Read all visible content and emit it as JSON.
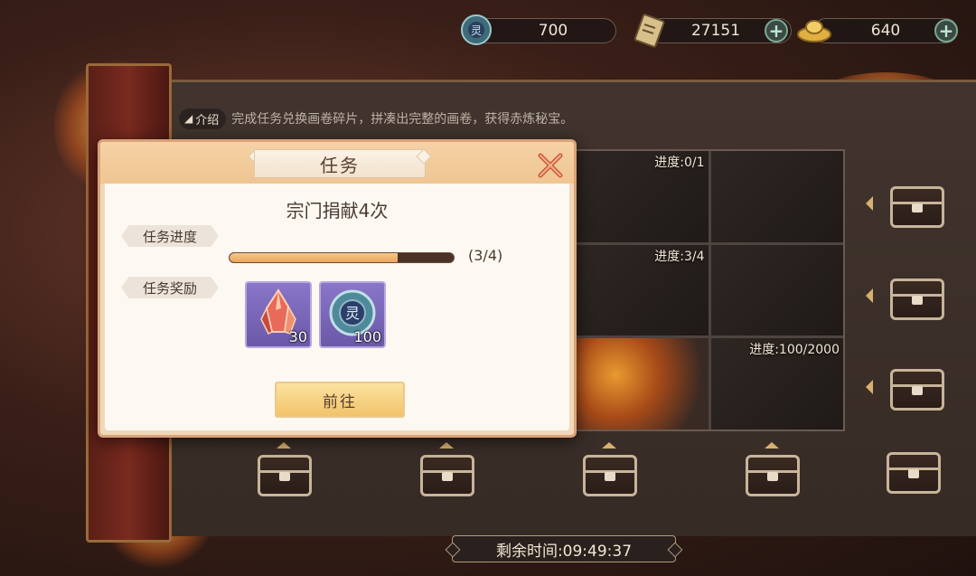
{
  "currencies": [
    {
      "value": "700",
      "icon": "jade-token-icon"
    },
    {
      "value": "27151",
      "icon": "scroll-ticket-icon"
    },
    {
      "value": "640",
      "icon": "gold-ingot-icon"
    }
  ],
  "intro": {
    "tag": "介绍",
    "text": "完成任务兑换画卷碎片，拼凑出完整的画卷，获得赤炼秘宝。"
  },
  "puzzle": {
    "cells": [
      {
        "progress": "进度:0/1"
      },
      {
        "progress": ""
      },
      {
        "progress": "进度:3/4"
      },
      {
        "progress": ""
      },
      {
        "progress": ""
      },
      {
        "progress": "进度:100/2000"
      }
    ]
  },
  "timer": "剩余时间:09:49:37",
  "modal": {
    "title": "任务",
    "task_name": "宗门捐献4次",
    "progress_label": "任务进度",
    "progress_text": "(3/4)",
    "progress": {
      "current": 3,
      "total": 4
    },
    "reward_label": "任务奖励",
    "rewards": [
      {
        "icon": "red-crystal-icon",
        "count": "30"
      },
      {
        "icon": "jade-token-icon",
        "count": "100"
      }
    ],
    "go_button": "前往"
  },
  "colors": {
    "accent_gold": "#f2c36a",
    "progress_fill": "#e9a65e",
    "reward_bg": "#7a66b8"
  }
}
